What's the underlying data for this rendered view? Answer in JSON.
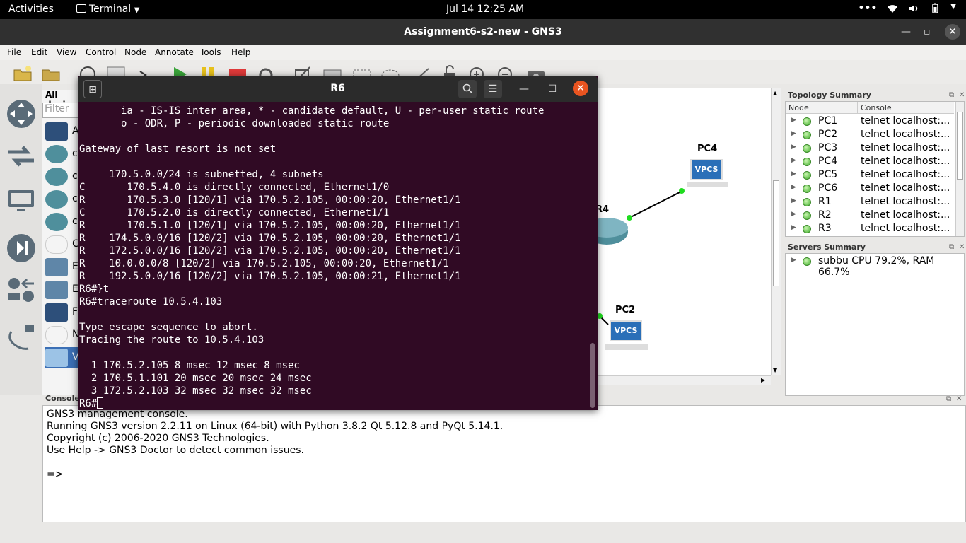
{
  "topbar": {
    "activities": "Activities",
    "app_name": "Terminal",
    "clock": "Jul 14  12:25 AM"
  },
  "gns3": {
    "title": "Assignment6-s2-new - GNS3",
    "menu": [
      "File",
      "Edit",
      "View",
      "Control",
      "Node",
      "Annotate",
      "Tools",
      "Help"
    ],
    "devices_header": "All devic",
    "filter_placeholder": "Filter",
    "device_labels": [
      "A",
      "c",
      "c",
      "c",
      "c",
      "C",
      "E",
      "E",
      "F",
      "N",
      "V"
    ],
    "canvas": {
      "nodes": [
        {
          "label": "PC4",
          "icon_text": "VPCS"
        },
        {
          "label": "R4"
        },
        {
          "label": "PC2",
          "icon_text": "VPCS"
        }
      ]
    },
    "topology_summary": {
      "title": "Topology Summary",
      "col_node": "Node",
      "col_console": "Console",
      "rows": [
        {
          "node": "PC1",
          "console": "telnet localhost:..."
        },
        {
          "node": "PC2",
          "console": "telnet localhost:..."
        },
        {
          "node": "PC3",
          "console": "telnet localhost:..."
        },
        {
          "node": "PC4",
          "console": "telnet localhost:..."
        },
        {
          "node": "PC5",
          "console": "telnet localhost:..."
        },
        {
          "node": "PC6",
          "console": "telnet localhost:..."
        },
        {
          "node": "R1",
          "console": "telnet localhost:..."
        },
        {
          "node": "R2",
          "console": "telnet localhost:..."
        },
        {
          "node": "R3",
          "console": "telnet localhost:..."
        }
      ]
    },
    "servers_summary": {
      "title": "Servers Summary",
      "server": "subbu CPU 79.2%, RAM 66.7%"
    },
    "console": {
      "title": "Console",
      "lines": [
        "GNS3 management console.",
        "Running GNS3 version 2.2.11 on Linux (64-bit) with Python 3.8.2 Qt 5.12.8 and PyQt 5.14.1.",
        "Copyright (c) 2006-2020 GNS3 Technologies.",
        "Use Help -> GNS3 Doctor to detect common issues.",
        "",
        "=>"
      ]
    }
  },
  "terminal": {
    "title": "R6",
    "lines": [
      "       ia - IS-IS inter area, * - candidate default, U - per-user static route",
      "       o - ODR, P - periodic downloaded static route",
      "",
      "Gateway of last resort is not set",
      "",
      "     170.5.0.0/24 is subnetted, 4 subnets",
      "C       170.5.4.0 is directly connected, Ethernet1/0",
      "R       170.5.3.0 [120/1] via 170.5.2.105, 00:00:20, Ethernet1/1",
      "C       170.5.2.0 is directly connected, Ethernet1/1",
      "R       170.5.1.0 [120/1] via 170.5.2.105, 00:00:20, Ethernet1/1",
      "R    174.5.0.0/16 [120/2] via 170.5.2.105, 00:00:20, Ethernet1/1",
      "R    172.5.0.0/16 [120/2] via 170.5.2.105, 00:00:20, Ethernet1/1",
      "R    10.0.0.0/8 [120/2] via 170.5.2.105, 00:00:20, Ethernet1/1",
      "R    192.5.0.0/16 [120/2] via 170.5.2.105, 00:00:21, Ethernet1/1",
      "R6#}t",
      "R6#traceroute 10.5.4.103",
      "",
      "Type escape sequence to abort.",
      "Tracing the route to 10.5.4.103",
      "",
      "  1 170.5.2.105 8 msec 12 msec 8 msec",
      "  2 170.5.1.101 20 msec 20 msec 24 msec",
      "  3 172.5.2.103 32 msec 32 msec 32 msec"
    ],
    "prompt": "R6#"
  }
}
